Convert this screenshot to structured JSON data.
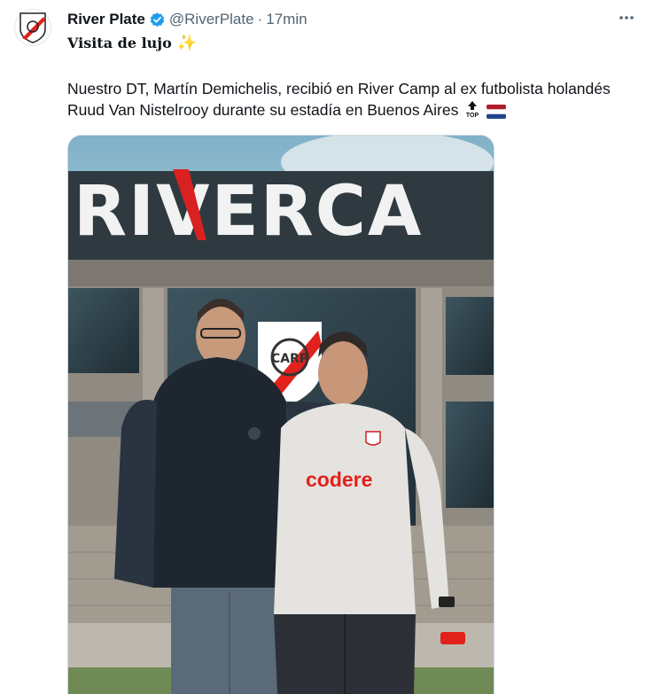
{
  "account": {
    "name": "River Plate",
    "handle": "@RiverPlate",
    "separator": "·",
    "time": "17min"
  },
  "tweet": {
    "title": "Visita de lujo",
    "body": "Nuestro DT, Martín Demichelis, recibió en River Camp al ex futbolista holandés Ruud Van Nistelrooy durante su estadía en Buenos Aires"
  },
  "media": {
    "building_sign": "RIVERCA",
    "shirt_sponsor": "codere",
    "badge_initials": "CARP"
  },
  "icons": {
    "verified": "verified-badge-icon",
    "more": "more-options-icon",
    "sparkles": "sparkles-icon",
    "top": "top-arrow-icon",
    "flag": "netherlands-flag-icon"
  },
  "colors": {
    "verified_blue": "#1d9bf0",
    "muted_text": "#536471",
    "river_red": "#e2211c"
  }
}
